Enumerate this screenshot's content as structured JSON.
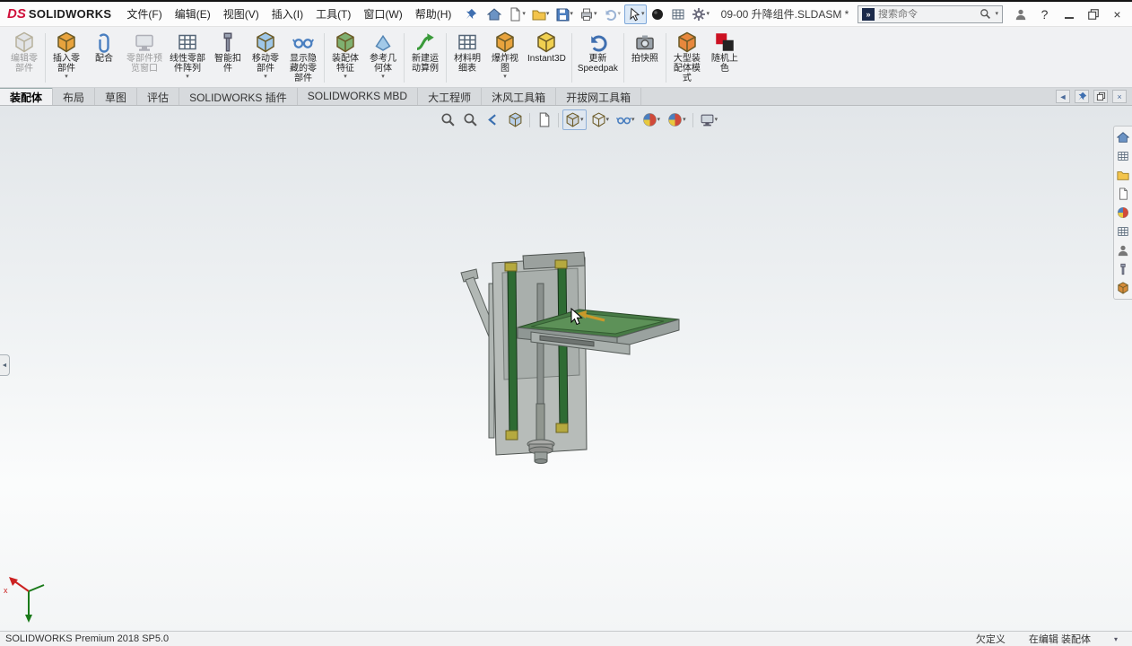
{
  "titlebar": {
    "logo_prefix": "DS",
    "logo_name": "SOLIDWORKS",
    "menus": [
      "文件(F)",
      "编辑(E)",
      "视图(V)",
      "插入(I)",
      "工具(T)",
      "窗口(W)",
      "帮助(H)"
    ],
    "document_title": "09-00 升降组件.SLDASM *",
    "search_placeholder": "搜索命令",
    "help_label": "?"
  },
  "quick_access_icons": [
    "home-icon",
    "new-document-icon",
    "open-folder-icon",
    "save-icon",
    "print-icon",
    "undo-icon",
    "select-cursor-icon",
    "rebuild-sphere-icon",
    "file-properties-icon",
    "options-gear-icon"
  ],
  "ribbon": {
    "buttons": [
      {
        "label": "编辑零\n部件"
      },
      {
        "label": "插入零\n部件"
      },
      {
        "label": "配合"
      },
      {
        "label": "零部件预\n览窗口"
      },
      {
        "label": "线性零部\n件阵列"
      },
      {
        "label": "智能扣\n件"
      },
      {
        "label": "移动零\n部件"
      },
      {
        "label": "显示隐\n藏的零\n部件"
      },
      {
        "label": "装配体\n特征"
      },
      {
        "label": "参考几\n何体"
      },
      {
        "label": "新建运\n动算例"
      },
      {
        "label": "材料明\n细表"
      },
      {
        "label": "爆炸视\n图"
      },
      {
        "label": "Instant3D"
      },
      {
        "label": "更新\nSpeedpak"
      },
      {
        "label": "拍快照"
      },
      {
        "label": "大型装\n配体模\n式"
      },
      {
        "label": "随机上\n色"
      }
    ]
  },
  "tabs": {
    "items": [
      "装配体",
      "布局",
      "草图",
      "评估",
      "SOLIDWORKS 插件",
      "SOLIDWORKS MBD",
      "大工程师",
      "沐风工具箱",
      "开拔网工具箱"
    ],
    "active": "装配体"
  },
  "viewport": {
    "hud_icons": [
      "zoom-to-fit",
      "zoom-to-area",
      "previous-view",
      "section-view",
      "annotations",
      "view-orientation",
      "display-style",
      "hide-show-items",
      "edit-appearance",
      "apply-scene",
      "view-settings"
    ],
    "model_name": "升降组件 lifting assembly",
    "triad_x_label": "x"
  },
  "taskpane_icons": [
    "solidworks-resources",
    "design-library",
    "file-explorer",
    "view-palette",
    "appearances-scenes",
    "custom-properties",
    "solidworks-forum",
    "tool-library",
    "addin-panel"
  ],
  "statusbar": {
    "product": "SOLIDWORKS Premium 2018 SP5.0",
    "definition_state": "欠定义",
    "edit_state": "在编辑 装配体"
  },
  "glyphs": {
    "caret_down": "▾",
    "caret_left": "◄",
    "close": "×",
    "search_badge": "»"
  },
  "colors": {
    "accent_blue": "#7da7d9",
    "rail_green": "#2e6b33",
    "table_green": "#477a45",
    "block_yellow": "#b5a93f",
    "logo_red": "#d0103a"
  }
}
